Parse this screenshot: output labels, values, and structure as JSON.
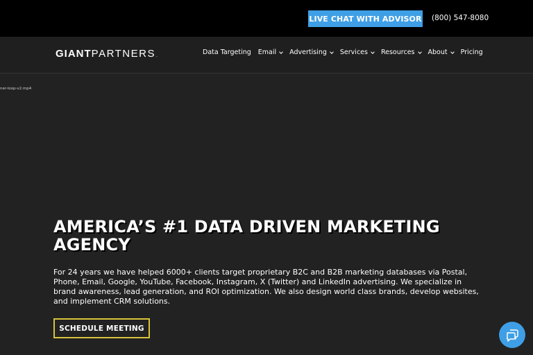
{
  "topbar": {
    "chat_label": "LIVE CHAT WITH ADVISOR",
    "phone": "(800) 547-8080"
  },
  "logo": {
    "part1": "GIANT",
    "part2": "PARTNERS",
    "mark": "."
  },
  "nav": {
    "items": [
      {
        "label": "Data Targeting",
        "dropdown": false
      },
      {
        "label": "Email",
        "dropdown": true
      },
      {
        "label": "Advertising",
        "dropdown": true
      },
      {
        "label": "Services",
        "dropdown": true
      },
      {
        "label": "Resources",
        "dropdown": true
      },
      {
        "label": "About",
        "dropdown": true
      },
      {
        "label": "Pricing",
        "dropdown": false
      }
    ]
  },
  "video": {
    "filename": "ner-loop-v2.mp4"
  },
  "hero": {
    "title_line1": "AMERICA’S #1 DATA DRIVEN MARKETING",
    "title_line2": "AGENCY",
    "body": "For 24 years we have helped 6000+ clients target proprietary B2C and B2B marketing databases via Postal, Phone, Email, Google, YouTube, Facebook, Instagram, X (Twitter) and LinkedIn advertising. We specialize in brand awareness, lead generation, and ROI optimization. We also design world class brands, develop websites, and implement CRM solutions.",
    "cta_label": "SCHEDULE MEETING"
  },
  "chat_widget": {
    "icon": "chat-bubbles-icon"
  },
  "colors": {
    "accent_blue": "#3f9fe6",
    "cta_border": "#d8c33a",
    "hero_bg": "#222222",
    "topbar_bg": "#000000"
  }
}
